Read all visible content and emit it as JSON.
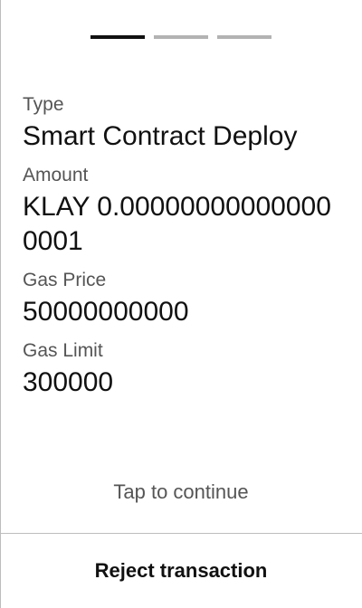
{
  "stepper": {
    "total_steps": 3,
    "current_step": 1
  },
  "transaction": {
    "type_label": "Type",
    "type_value": "Smart Contract Deploy",
    "amount_label": "Amount",
    "amount_value": "KLAY 0.000000000000000001",
    "gas_price_label": "Gas Price",
    "gas_price_value": "50000000000",
    "gas_limit_label": "Gas Limit",
    "gas_limit_value": "300000"
  },
  "hint_text": "Tap to continue",
  "reject_label": "Reject transaction",
  "colors": {
    "active_step": "#111111",
    "inactive_step": "#b3b3b3",
    "label": "#555555",
    "text": "#111111"
  }
}
